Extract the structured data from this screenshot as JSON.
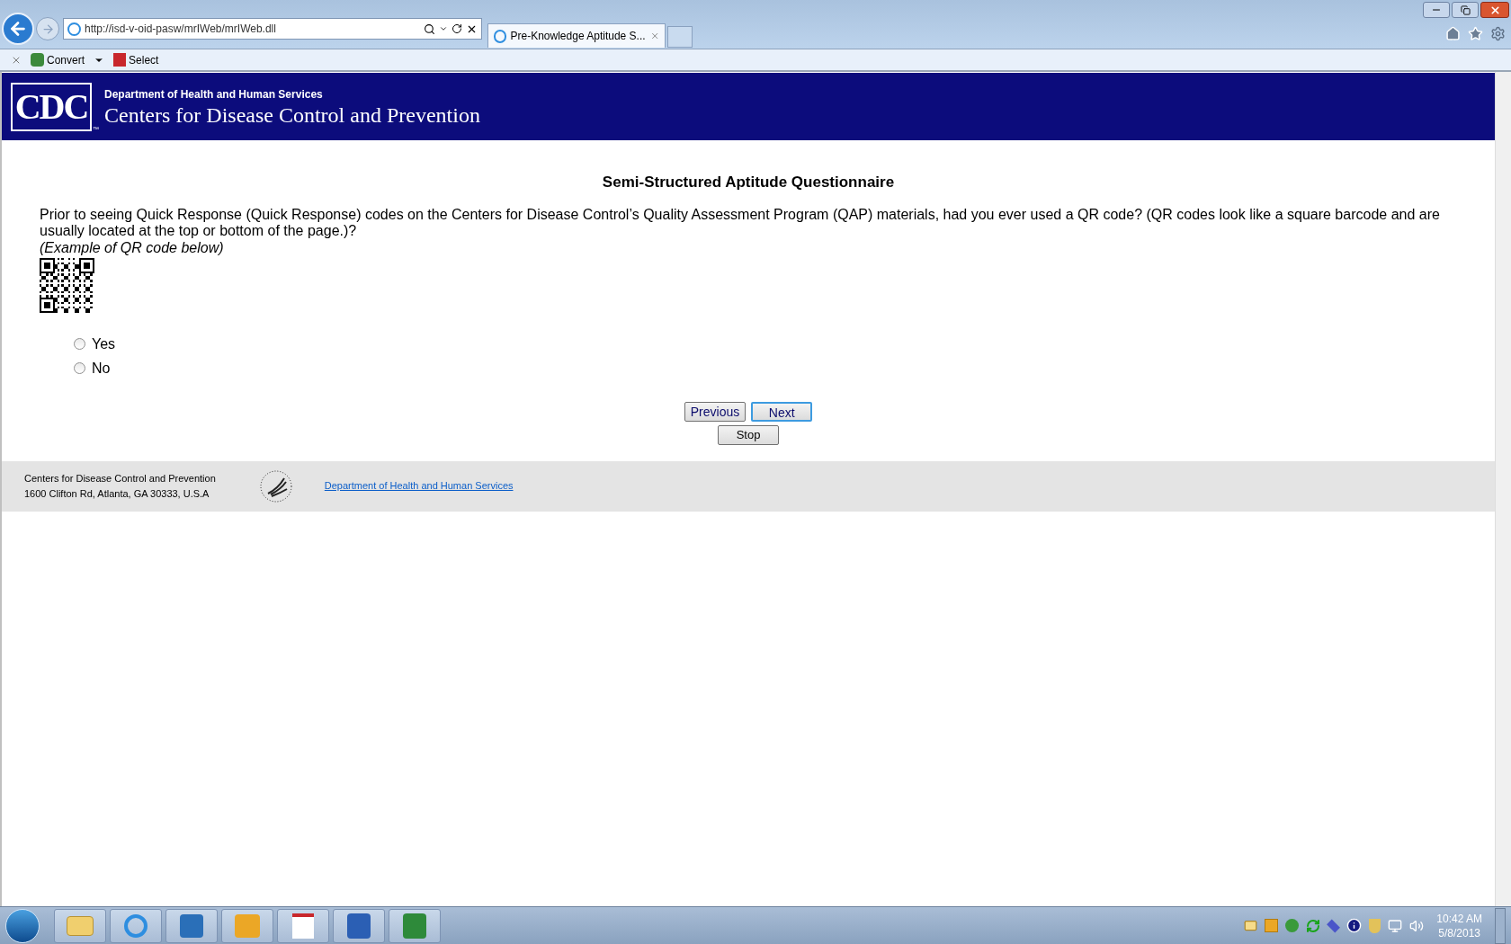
{
  "browser": {
    "address": "http://isd-v-oid-pasw/mrIWeb/mrIWeb.dll",
    "tabs": [
      {
        "title": "Pre-Knowledge Aptitude S...",
        "selected": true
      }
    ]
  },
  "command_bar": {
    "items": [
      "Convert",
      "Select"
    ]
  },
  "header": {
    "logo": "CDC",
    "trademark": "™",
    "department": "Department of Health and Human Services",
    "organization": "Centers for Disease Control and Prevention"
  },
  "question": {
    "title": "Semi-Structured Aptitude Questionnaire",
    "text": "Prior to seeing Quick Response (Quick Response) codes on the Centers for Disease Control’s Quality Assessment Program (QAP) materials, had you ever used a QR code? (QR codes look like a square barcode and are usually located at the top or bottom of the page.)?",
    "example": "(Example of QR code below)",
    "options": [
      {
        "label": "Yes",
        "selected": false
      },
      {
        "label": "No",
        "selected": false
      }
    ]
  },
  "nav_buttons": [
    {
      "label": "Previous",
      "default": false
    },
    {
      "label": "Next",
      "default": true
    }
  ],
  "stop_button": "Stop",
  "footer": {
    "name": "Centers for Disease Control and Prevention",
    "address": "1600 Clifton Rd, Atlanta, GA 30333, U.S.A",
    "link": "Department of Health and Human Services"
  },
  "taskbar": {
    "time": "10:42 AM",
    "date": "5/8/2013"
  }
}
